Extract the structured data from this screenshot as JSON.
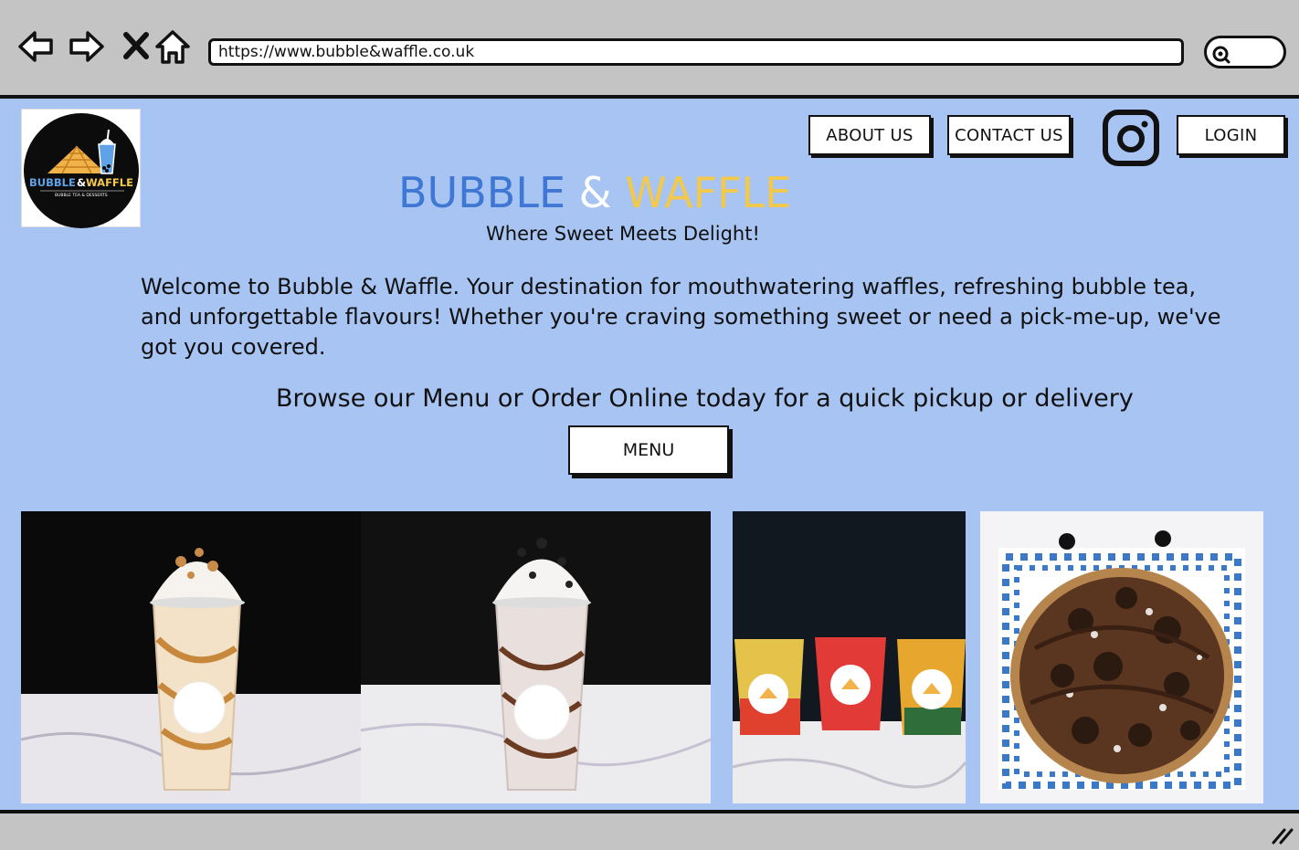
{
  "browser": {
    "url": "https://www.bubble&waffle.co.uk"
  },
  "header": {
    "logo": {
      "text": "BUBBLE & WAFFLE",
      "subtext": "BUBBLE TEA & DESSERTS"
    },
    "nav": {
      "about_label": "ABOUT US",
      "contact_label": "CONTACT US",
      "login_label": "LOGIN"
    }
  },
  "hero": {
    "brand_part1": "BUBBLE",
    "brand_amp": "&",
    "brand_part2": "WAFFLE",
    "tagline": "Where Sweet Meets Delight!",
    "welcome": "Welcome to Bubble & Waffle. Your destination for mouthwatering waffles, refreshing bubble tea, and unforgettable flavours! Whether you're craving something sweet or need a pick-me-up, we've got you covered.",
    "browse": "Browse our Menu or Order Online today for a quick pickup or delivery",
    "menu_label": "MENU"
  },
  "colors": {
    "page_bg": "#a8c4f2",
    "brand_blue": "#3e77d4",
    "brand_yellow": "#f2c94c",
    "chrome_gray": "#c4c4c4"
  },
  "icons": [
    "back-arrow-icon",
    "forward-arrow-icon",
    "close-icon",
    "home-icon",
    "search-icon",
    "instagram-icon",
    "resize-handle-icon"
  ]
}
